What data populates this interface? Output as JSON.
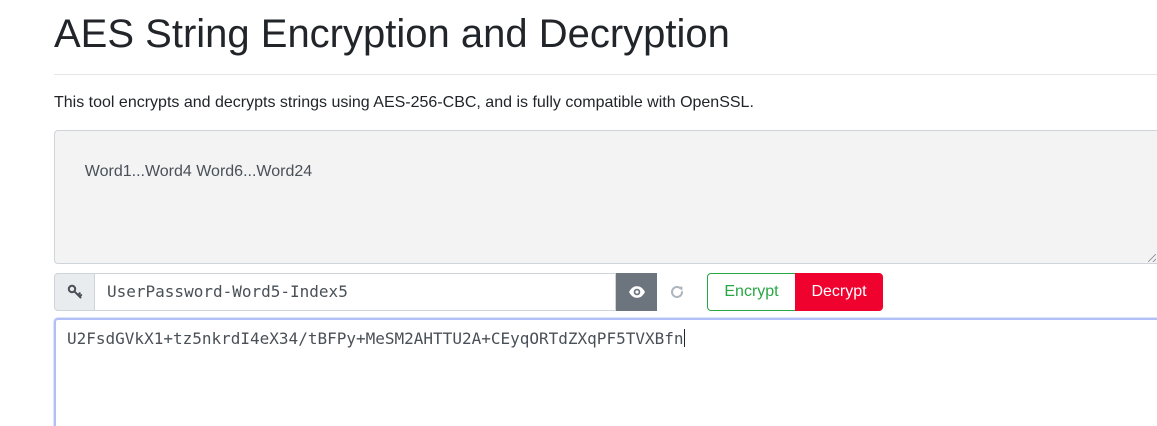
{
  "page": {
    "title": "AES String Encryption and Decryption",
    "description": "This tool encrypts and decrypts strings using AES-256-CBC, and is fully compatible with OpenSSL."
  },
  "plaintext": {
    "value": "Word1...Word4 Word6...Word24"
  },
  "key": {
    "value": "UserPassword-Word5-Index5",
    "addon_icon": "key-icon",
    "toggle_icon": "eye-icon",
    "refresh_icon": "refresh-icon"
  },
  "actions": {
    "encrypt_label": "Encrypt",
    "decrypt_label": "Decrypt"
  },
  "ciphertext": {
    "value": "U2FsdGVkX1+tz5nkrdI4eX34/tBFPy+MeSM2AHTTU2A+CEyqORTdZXqPF5TVXBfn"
  },
  "colors": {
    "encrypt": "#28a745",
    "decrypt": "#f0022f",
    "toggle_bg": "#6c757d",
    "textarea_bg": "#f3f3f3",
    "focus_border": "#b3c0f7"
  }
}
